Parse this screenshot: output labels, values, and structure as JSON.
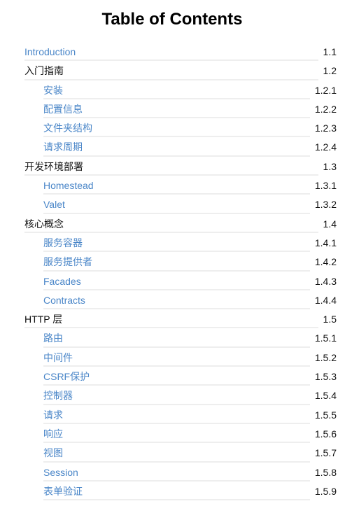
{
  "title": "Table of Contents",
  "colors": {
    "link": "#4a86c8",
    "text": "#111111",
    "rule": "#eeeeee"
  },
  "entries": [
    {
      "label": "Introduction",
      "num": "1.1",
      "level": 1,
      "link": true
    },
    {
      "label": "入门指南",
      "num": "1.2",
      "level": 1,
      "link": false
    },
    {
      "label": "安装",
      "num": "1.2.1",
      "level": 2,
      "link": true
    },
    {
      "label": "配置信息",
      "num": "1.2.2",
      "level": 2,
      "link": true
    },
    {
      "label": "文件夹结构",
      "num": "1.2.3",
      "level": 2,
      "link": true
    },
    {
      "label": "请求周期",
      "num": "1.2.4",
      "level": 2,
      "link": true
    },
    {
      "label": "开发环境部署",
      "num": "1.3",
      "level": 1,
      "link": false
    },
    {
      "label": "Homestead",
      "num": "1.3.1",
      "level": 2,
      "link": true
    },
    {
      "label": "Valet",
      "num": "1.3.2",
      "level": 2,
      "link": true
    },
    {
      "label": "核心概念",
      "num": "1.4",
      "level": 1,
      "link": false
    },
    {
      "label": "服务容器",
      "num": "1.4.1",
      "level": 2,
      "link": true
    },
    {
      "label": "服务提供者",
      "num": "1.4.2",
      "level": 2,
      "link": true
    },
    {
      "label": "Facades",
      "num": "1.4.3",
      "level": 2,
      "link": true
    },
    {
      "label": "Contracts",
      "num": "1.4.4",
      "level": 2,
      "link": true
    },
    {
      "label": "HTTP 层",
      "num": "1.5",
      "level": 1,
      "link": false
    },
    {
      "label": "路由",
      "num": "1.5.1",
      "level": 2,
      "link": true
    },
    {
      "label": "中间件",
      "num": "1.5.2",
      "level": 2,
      "link": true
    },
    {
      "label": "CSRF保护",
      "num": "1.5.3",
      "level": 2,
      "link": true
    },
    {
      "label": "控制器",
      "num": "1.5.4",
      "level": 2,
      "link": true
    },
    {
      "label": "请求",
      "num": "1.5.5",
      "level": 2,
      "link": true
    },
    {
      "label": "响应",
      "num": "1.5.6",
      "level": 2,
      "link": true
    },
    {
      "label": "视图",
      "num": "1.5.7",
      "level": 2,
      "link": true
    },
    {
      "label": "Session",
      "num": "1.5.8",
      "level": 2,
      "link": true
    },
    {
      "label": "表单验证",
      "num": "1.5.9",
      "level": 2,
      "link": true
    }
  ]
}
